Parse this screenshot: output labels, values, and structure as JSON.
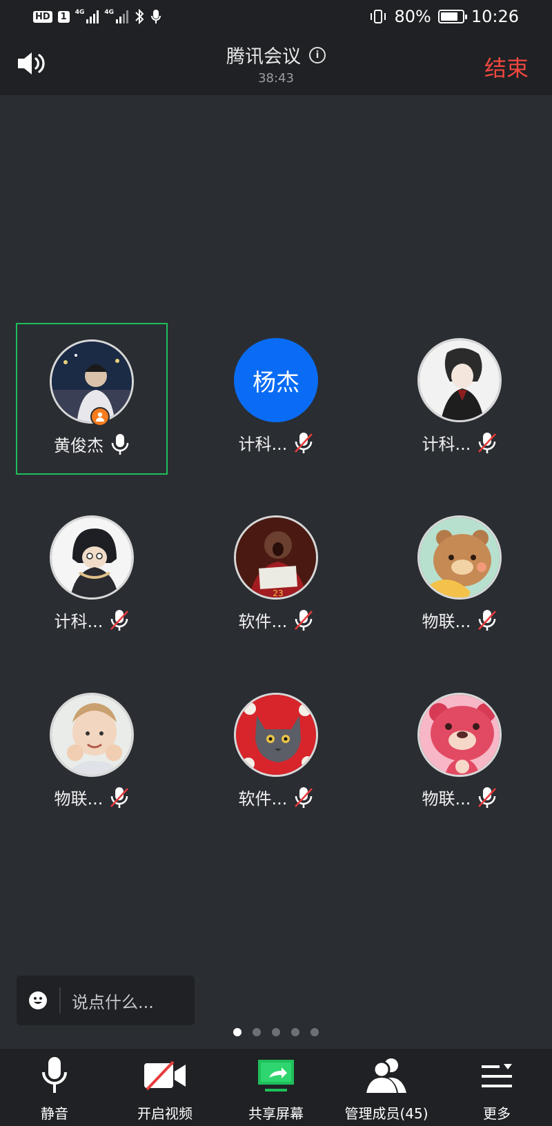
{
  "status_bar": {
    "hd": "HD",
    "sim": "1",
    "net1": "4G",
    "net2": "4G",
    "battery": "80%",
    "battery_level": 0.8,
    "time": "10:26"
  },
  "header": {
    "title": "腾讯会议",
    "duration": "38:43",
    "end_label": "结束"
  },
  "participants": [
    {
      "name": "黄俊杰",
      "avatar_text": "",
      "muted": false,
      "host": true
    },
    {
      "name": "计科...",
      "avatar_text": "杨杰",
      "muted": true,
      "host": false
    },
    {
      "name": "计科...",
      "avatar_text": "",
      "muted": true,
      "host": false
    },
    {
      "name": "计科...",
      "avatar_text": "",
      "muted": true,
      "host": false
    },
    {
      "name": "软件...",
      "avatar_text": "",
      "muted": true,
      "host": false
    },
    {
      "name": "物联...",
      "avatar_text": "",
      "muted": true,
      "host": false
    },
    {
      "name": "物联...",
      "avatar_text": "",
      "muted": true,
      "host": false
    },
    {
      "name": "软件...",
      "avatar_text": "",
      "muted": true,
      "host": false
    },
    {
      "name": "物联...",
      "avatar_text": "",
      "muted": true,
      "host": false
    }
  ],
  "chat": {
    "placeholder": "说点什么..."
  },
  "pager": {
    "pages": 5,
    "current": 1
  },
  "toolbar": {
    "mute_label": "静音",
    "video_label": "开启视频",
    "share_label": "共享屏幕",
    "members_label": "管理成员(45)",
    "more_label": "更多"
  },
  "colors": {
    "accent_green": "#1fbf5c",
    "end_red": "#f0473f",
    "avatar_blue": "#0a6cf5",
    "host_orange": "#f57c1f"
  }
}
